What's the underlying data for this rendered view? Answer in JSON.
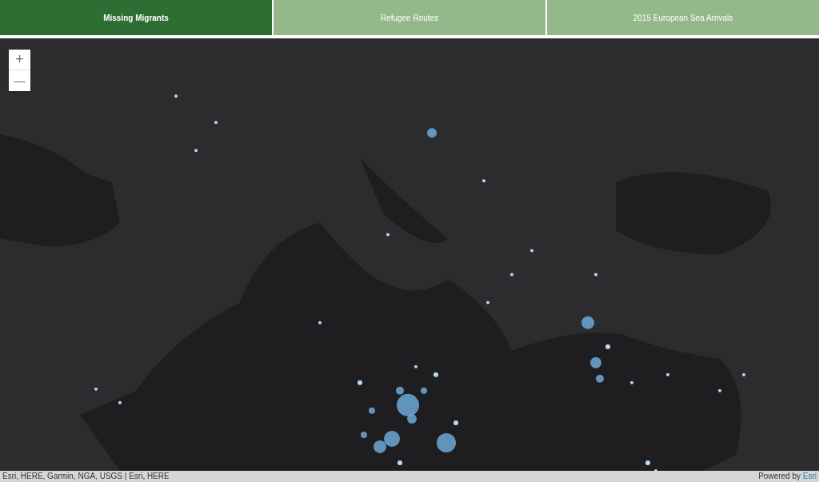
{
  "tabs": [
    {
      "label": "Missing Migrants",
      "selected": true
    },
    {
      "label": "Refugee Routes",
      "selected": false
    },
    {
      "label": "2015 European Sea Arrivals",
      "selected": false
    }
  ],
  "zoom": {
    "in": "+",
    "out": "—"
  },
  "attribution": {
    "sources": "Esri, HERE, Garmin, NGA, USGS | Esri, HERE",
    "powered": "Powered by ",
    "brand": "Esri"
  }
}
